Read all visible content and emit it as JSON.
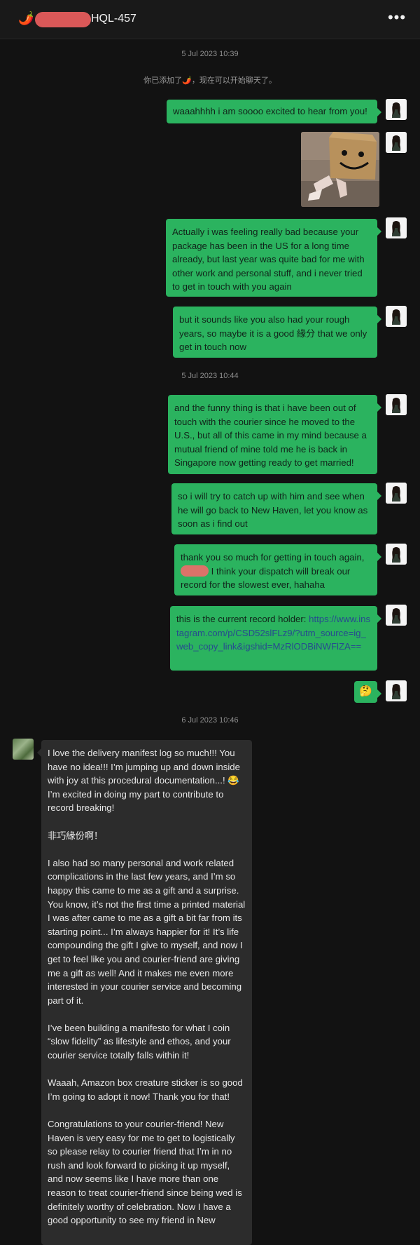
{
  "header": {
    "chili": "🌶️",
    "title": "HQL-457",
    "more": "•••"
  },
  "timestamps": [
    "5 Jul 2023 10:39",
    "5 Jul 2023 10:44",
    "6 Jul 2023 10:46"
  ],
  "system_message": "你已添加了🌶️，现在可以开始聊天了。",
  "messages": {
    "m1": "waaahhhh i am soooo excited to hear from you!",
    "m3": "Actually i was feeling really bad because your package has been in the US for a long time already, but last year was quite bad for me with other work and personal stuff, and i never tried to get in touch with you again",
    "m4": "but it sounds like you also had your rough years, so maybe it is a good 緣分 that we only get in touch now",
    "m5": "and the funny thing is that i have been out of touch with the courier since he moved to the U.S., but all of this came in my mind because a mutual friend of mine told me he is back in Singapore now getting ready to get married!",
    "m6": "so i will try to catch up with him and see when he will go back to New Haven, let you know as soon as i find out",
    "m7a": "thank you so much for getting in touch again,",
    "m7b": " I think your dispatch will break our record for the slowest ever, hahaha",
    "m8_text": "this is the current record holder: ",
    "m8_link": "https://www.instagram.com/p/CSD52slFLz9/?utm_source=ig_web_copy_link&igshid=MzRlODBiNWFlZA==",
    "m9": "🤔"
  },
  "reply": {
    "p1": "I love the delivery manifest log so much!!! You have no idea!!! I’m jumping up and down inside with joy at this procedural documentation...! 😂 I’m excited in doing my part to contribute to record breaking!",
    "p2": "非巧緣份啊！",
    "p3": "I also had so many personal and work related complications in the last few years, and I’m so happy this came to me as a gift and a surprise. You know, it’s not the first time a printed material I was after came to me as a gift a bit far from its starting point... I’m always happier for it! It’s life compounding the gift I give to myself, and now I get to feel like you and courier-friend are giving me a gift as well! And it makes me even more interested in your courier service and becoming part of it.",
    "p4": "I’ve been building a manifesto for what I coin “slow fidelity” as lifestyle and ethos, and your courier service totally falls within it!",
    "p5": "Waaah, Amazon box creature sticker is so good I’m going to adopt it now! Thank you for that!",
    "p6": "Congratulations to your courier-friend! New Haven is very easy for me to get to logistically so please relay to courier friend that I’m in no rush and look forward to picking it up myself, and now seems like I have more than one reason to treat courier-friend since being wed is definitely worthy of celebration. Now I have a good opportunity to see my friend in New"
  },
  "colors": {
    "background": "#121212",
    "outgoing_bubble": "#2bb35f",
    "incoming_bubble": "#2c2c2c",
    "link": "#274b8f",
    "redaction": "#ef5f5f"
  }
}
